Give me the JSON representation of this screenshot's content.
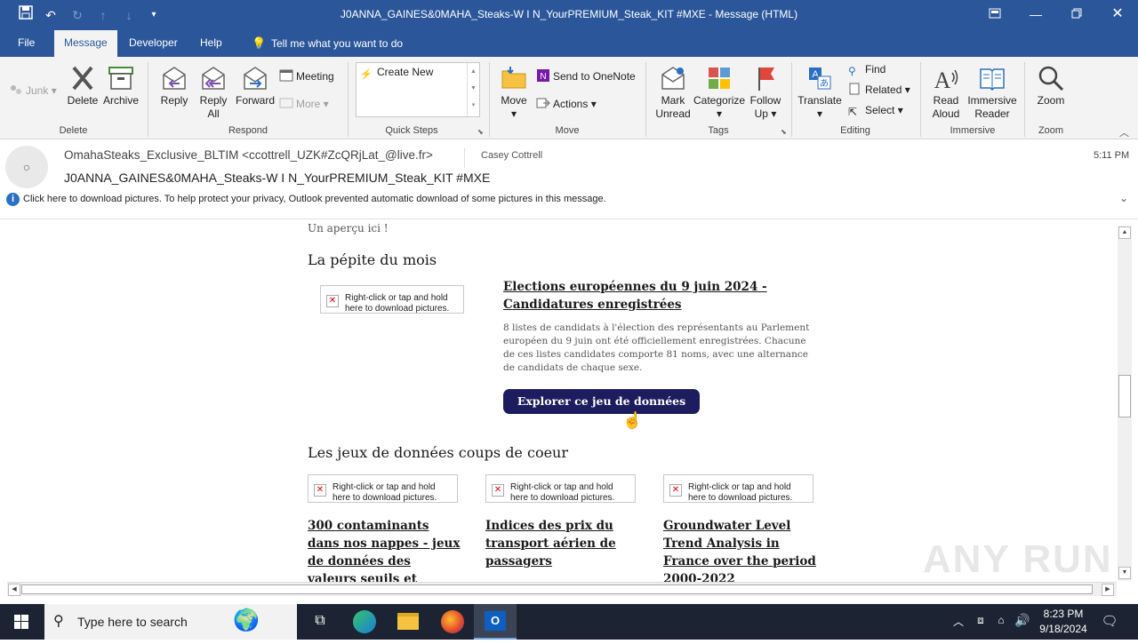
{
  "window": {
    "title": "J0ANNA_GAINES&0MAHA_Steaks-W I N_YourPREMIUM_Steak_KIT #MXE  -  Message (HTML)"
  },
  "tabs": [
    {
      "label": "File"
    },
    {
      "label": "Message"
    },
    {
      "label": "Developer"
    },
    {
      "label": "Help"
    }
  ],
  "tell_me": "Tell me what you want to do",
  "ribbon": {
    "delete_group": {
      "label": "Delete",
      "junk": "Junk",
      "delete": "Delete",
      "archive": "Archive"
    },
    "respond_group": {
      "label": "Respond",
      "reply": "Reply",
      "reply_all": "Reply All",
      "forward": "Forward",
      "meeting": "Meeting",
      "more": "More"
    },
    "quick_steps": {
      "label": "Quick Steps",
      "create_new": "Create New"
    },
    "move_group": {
      "label": "Move",
      "move": "Move",
      "onenote": "Send to OneNote",
      "actions": "Actions"
    },
    "tags_group": {
      "label": "Tags",
      "mark_unread": "Mark Unread",
      "categorize": "Categorize",
      "follow_up": "Follow Up"
    },
    "editing_group": {
      "label": "Editing",
      "translate": "Translate",
      "find": "Find",
      "related": "Related",
      "select": "Select"
    },
    "immersive_group": {
      "label": "Immersive",
      "read_aloud": "Read Aloud",
      "immersive_reader": "Immersive Reader"
    },
    "zoom_group": {
      "label": "Zoom",
      "zoom": "Zoom"
    }
  },
  "message": {
    "from": "OmahaSteaks_Exclusive_BLTIM <ccottrell_UZK#ZcQRjLat_@live.fr>",
    "to": "Casey Cottrell",
    "time": "5:11 PM",
    "subject": "J0ANNA_GAINES&0MAHA_Steaks-W I N_YourPREMIUM_Steak_KIT  #MXE",
    "infobar": "Click here to download pictures. To help protect your privacy, Outlook prevented automatic download of some pictures in this message."
  },
  "body": {
    "apercu": "Un aperçu ici !",
    "pepite_title": "La pépite du mois",
    "img_placeholder": "Right-click or tap and hold here to download pictures.",
    "article_title": "Elections européennes du 9 juin 2024 - Candidatures enregistrées",
    "article_text": "8 listes de candidats à l'élection des représentants au Parlement européen du 9 juin ont été officiellement enregistrées. Chacune de ces listes candidates comporte  81 noms, avec une alternance de candidats de chaque sexe.",
    "cta": "Explorer ce jeu de données",
    "coups_title": "Les jeux de données coups de coeur",
    "cards": [
      {
        "title": "300 contaminants dans nos nappes - jeux de données des valeurs seuils et"
      },
      {
        "title": "Indices des prix du transport aérien de passagers"
      },
      {
        "title": "Groundwater Level Trend Analysis in France over the period 2000-2022"
      }
    ]
  },
  "watermark": "ANY RUN",
  "taskbar": {
    "search_placeholder": "Type here to search",
    "time": "8:23 PM",
    "date": "9/18/2024"
  },
  "colors": {
    "office_blue": "#2b579a",
    "cta_bg": "#1c1c5e",
    "taskbar_bg": "#1c2433"
  }
}
